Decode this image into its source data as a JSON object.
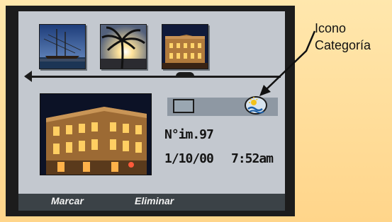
{
  "screen": {
    "image_number": "N°im.97",
    "date": "1/10/00",
    "time": "7:52am",
    "softkeys": [
      "Marcar",
      "Eliminar"
    ]
  },
  "thumbnails": [
    {
      "name": "harbor-ship-photo"
    },
    {
      "name": "palm-sunset-photo"
    },
    {
      "name": "building-night-photo"
    }
  ],
  "callout": {
    "line1": "Icono",
    "line2": "Categoría"
  },
  "colors": {
    "accent_background": "#ffd58a",
    "frame": "#1c1c1c",
    "screen": "#c3c8cf",
    "softbar": "#3b4247"
  }
}
